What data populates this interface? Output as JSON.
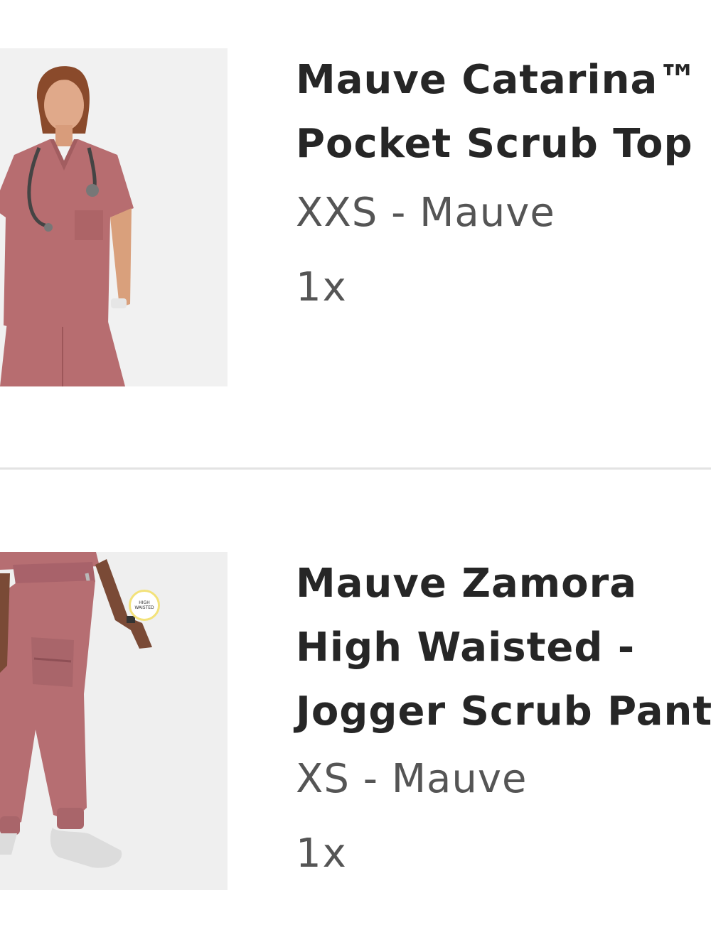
{
  "cart": {
    "items": [
      {
        "title": "Mauve Catarina™ - Pocket Scrub Top",
        "variant": "XXS - Mauve",
        "quantity": "1x",
        "image": {
          "background": "#f1f1f1",
          "garment_color": "#b76d70",
          "skin_color": "#d9a07c",
          "hair_color": "#8a4a2b"
        }
      },
      {
        "title": "Mauve Zamora High Waisted - Jogger Scrub Pants",
        "variant": "XS - Mauve",
        "quantity": "1x",
        "image": {
          "background": "#efefef",
          "garment_color": "#b66e72",
          "skin_color": "#7a4a36",
          "shoe_color": "#dcdcdc",
          "badge_text": "HIGH WAISTED",
          "badge_color": "#f3e27a"
        }
      }
    ]
  }
}
